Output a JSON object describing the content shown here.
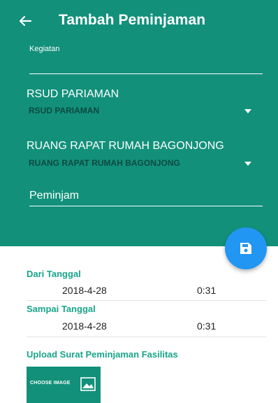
{
  "app_bar": {
    "title": "Tambah Peminjaman",
    "back_icon": "arrow-left-icon"
  },
  "form": {
    "kegiatan": {
      "label": "Kegiatan",
      "value": ""
    },
    "hospital": {
      "label": "RSUD PARIAMAN",
      "selected": "RSUD PARIAMAN"
    },
    "room": {
      "label": "RUANG RAPAT RUMAH BAGONJONG",
      "selected": "RUANG RAPAT RUMAH BAGONJONG"
    },
    "peminjam": {
      "placeholder": "Peminjam",
      "value": ""
    }
  },
  "fab": {
    "icon": "save-icon"
  },
  "dari": {
    "label": "Dari Tanggal",
    "date": "2018-4-28",
    "time": "0:31"
  },
  "sampai": {
    "label": "Sampai Tanggal",
    "date": "2018-4-28",
    "time": "0:31"
  },
  "upload": {
    "label": "Upload Surat Peminjaman Fasilitas",
    "button_label": "CHOOSE IMAGE",
    "icon": "image-icon"
  },
  "colors": {
    "header": "#12907a",
    "accent": "#17a589",
    "fab": "#2196f3",
    "select_text": "#0c4a40"
  }
}
